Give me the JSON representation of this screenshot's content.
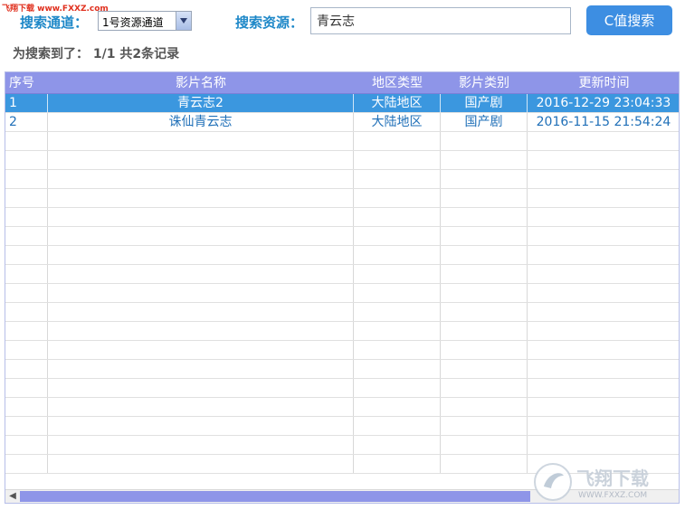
{
  "watermark_top": "飞翔下载 www.FXXZ.com",
  "search": {
    "channel_label": "搜索通道：",
    "channel_value": "1号资源通道",
    "source_label": "搜索资源：",
    "query": "青云志",
    "button_label": "C值搜索"
  },
  "result_summary": "为搜索到了： 1/1 共2条记录",
  "table": {
    "columns": [
      "序号",
      "影片名称",
      "地区类型",
      "影片类别",
      "更新时间"
    ],
    "rows": [
      [
        "1",
        "青云志2",
        "大陆地区",
        "国产剧",
        "2016-12-29 23:04:33"
      ],
      [
        "2",
        "诛仙青云志",
        "大陆地区",
        "国产剧",
        "2016-11-15 21:54:24"
      ]
    ],
    "selected_row": 0
  },
  "watermark_logo": {
    "title": "飞翔下载",
    "url": "WWW.FXXZ.COM"
  }
}
